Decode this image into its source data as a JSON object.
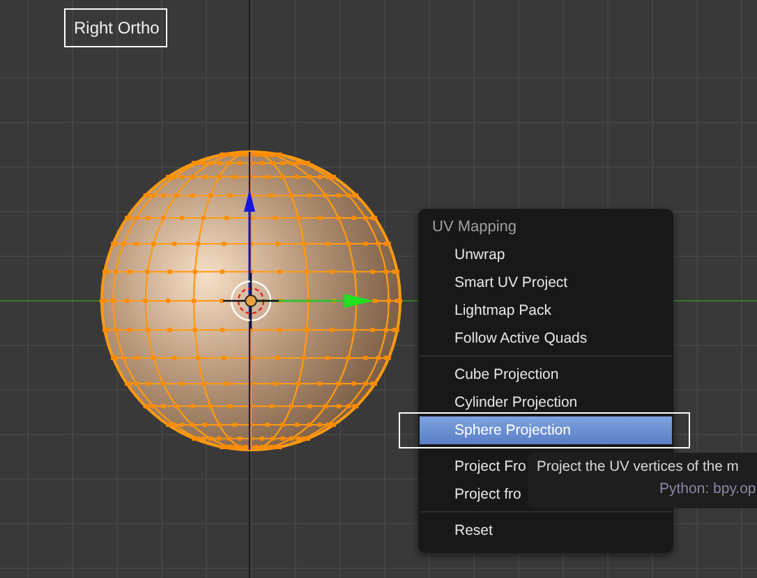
{
  "viewport": {
    "view_label": "Right Ortho"
  },
  "menu": {
    "title": "UV Mapping",
    "groups": [
      [
        {
          "label": "Unwrap",
          "selected": false
        },
        {
          "label": "Smart UV Project",
          "selected": false
        },
        {
          "label": "Lightmap Pack",
          "selected": false
        },
        {
          "label": "Follow Active Quads",
          "selected": false
        }
      ],
      [
        {
          "label": "Cube Projection",
          "selected": false
        },
        {
          "label": "Cylinder Projection",
          "selected": false
        },
        {
          "label": "Sphere Projection",
          "selected": true
        }
      ],
      [
        {
          "label": "Project Fro",
          "selected": false
        },
        {
          "label": "Project fro",
          "selected": false
        }
      ],
      [
        {
          "label": "Reset",
          "selected": false
        }
      ]
    ]
  },
  "tooltip": {
    "description": "Project the UV vertices of the m",
    "python": "Python: bpy.op"
  }
}
